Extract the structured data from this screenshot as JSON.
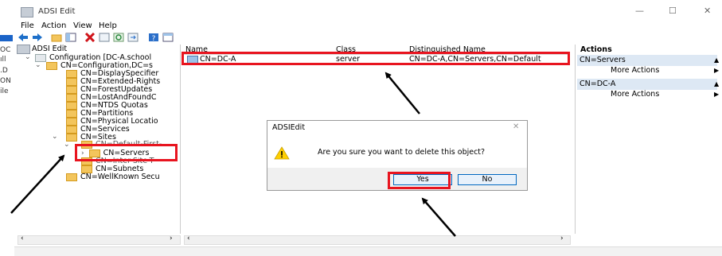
{
  "left_strip": [
    "OC",
    "ıll",
    ".D",
    "ON",
    "ile"
  ],
  "window": {
    "title": "ADSI Edit"
  },
  "window_controls": {
    "minimize": "—",
    "maximize": "☐",
    "close": "✕"
  },
  "menu": [
    "File",
    "Action",
    "View",
    "Help"
  ],
  "tree": {
    "root": "ADSI Edit",
    "config": "Configuration [DC-A.school",
    "configdc": "CN=Configuration,DC=s",
    "items": [
      "CN=DisplaySpecifier",
      "CN=Extended-Rights",
      "CN=ForestUpdates",
      "CN=LostAndFoundC",
      "CN=NTDS Quotas",
      "CN=Partitions",
      "CN=Physical Locatio",
      "CN=Services"
    ],
    "sites": "CN=Sites",
    "default_first": "CN=Default-First-",
    "servers": "CN=Servers",
    "inter_site": "CN=Inter-Site-T",
    "subnets": "CN=Subnets",
    "wellknown": "CN=WellKnown Secu"
  },
  "list": {
    "columns": [
      "Name",
      "Class",
      "Distinguished Name"
    ],
    "row": {
      "name": "CN=DC-A",
      "class": "server",
      "dn": "CN=DC-A,CN=Servers,CN=Default"
    }
  },
  "actions": {
    "header": "Actions",
    "section1": "CN=Servers",
    "more1": "More Actions",
    "section2": "CN=DC-A",
    "more2": "More Actions"
  },
  "dialog": {
    "title": "ADSIEdit",
    "message": "Are you sure you want to delete this object?",
    "yes": "Yes",
    "no": "No",
    "close": "✕"
  },
  "colors": {
    "highlight": "#e8141f",
    "folder": "#f3c55c",
    "selection": "#dde8f4"
  }
}
